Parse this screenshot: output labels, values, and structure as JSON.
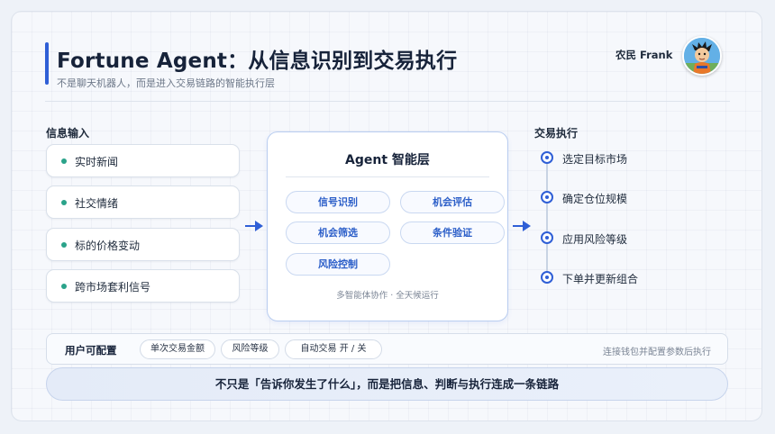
{
  "header": {
    "title": "Fortune Agent：从信息识别到交易执行",
    "subtitle": "不是聊天机器人，而是进入交易链路的智能执行层",
    "author": "农民 Frank"
  },
  "inputs": {
    "heading": "信息输入",
    "items": [
      "实时新闻",
      "社交情绪",
      "标的价格变动",
      "跨市场套利信号"
    ]
  },
  "agent": {
    "title": "Agent 智能层",
    "capabilities": [
      "信号识别",
      "机会评估",
      "机会筛选",
      "条件验证",
      "风险控制"
    ],
    "footer": "多智能体协作 · 全天候运行"
  },
  "execution": {
    "heading": "交易执行",
    "steps": [
      "选定目标市场",
      "确定仓位规模",
      "应用风险等级",
      "下单并更新组合"
    ]
  },
  "config": {
    "label": "用户可配置",
    "options": [
      "单次交易金额",
      "风险等级",
      "自动交易 开 / 关"
    ],
    "note": "连接钱包并配置参数后执行"
  },
  "banner": "不只是「告诉你发生了什么」，而是把信息、判断与执行连成一条链路",
  "colors": {
    "accent": "#2f5fd6",
    "input_dot": "#2aa38a",
    "chip_text": "#2b5ec8"
  }
}
